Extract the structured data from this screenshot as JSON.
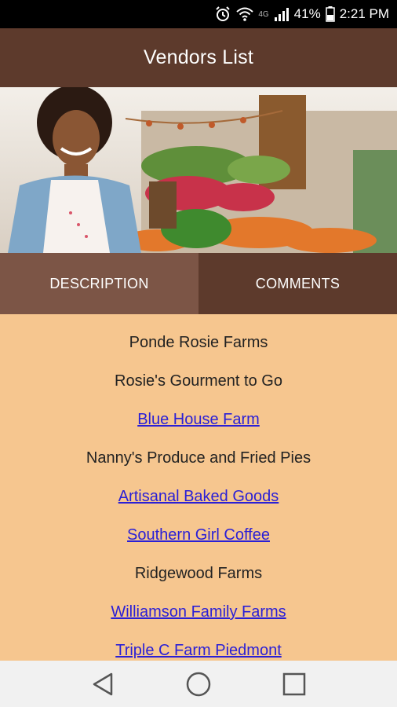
{
  "status": {
    "network": "4G",
    "battery": "41%",
    "time": "2:21 PM"
  },
  "header": {
    "title": "Vendors List"
  },
  "hero": {
    "image": "farmers-market-vendor-photo"
  },
  "tabs": [
    {
      "label": "DESCRIPTION",
      "active": true
    },
    {
      "label": "COMMENTS",
      "active": false
    }
  ],
  "vendors": [
    {
      "name": "Ponde Rosie Farms",
      "link": false
    },
    {
      "name": "Rosie's Gourment to Go",
      "link": false
    },
    {
      "name": "Blue House Farm",
      "link": true
    },
    {
      "name": "Nanny's Produce and Fried Pies",
      "link": false
    },
    {
      "name": "Artisanal Baked Goods",
      "link": true
    },
    {
      "name": "Southern Girl Coffee",
      "link": true
    },
    {
      "name": "Ridgewood Farms",
      "link": false
    },
    {
      "name": "Williamson Family Farms",
      "link": true
    },
    {
      "name": "Triple C Farm Piedmont",
      "link": true
    }
  ],
  "nav": {
    "back": "back-icon",
    "home": "home-icon",
    "recents": "recents-icon"
  },
  "colors": {
    "app_bar": "#5d3a2c",
    "tab_active": "#7c5546",
    "list_background": "#f6c68f",
    "link": "#2a1fd6"
  }
}
